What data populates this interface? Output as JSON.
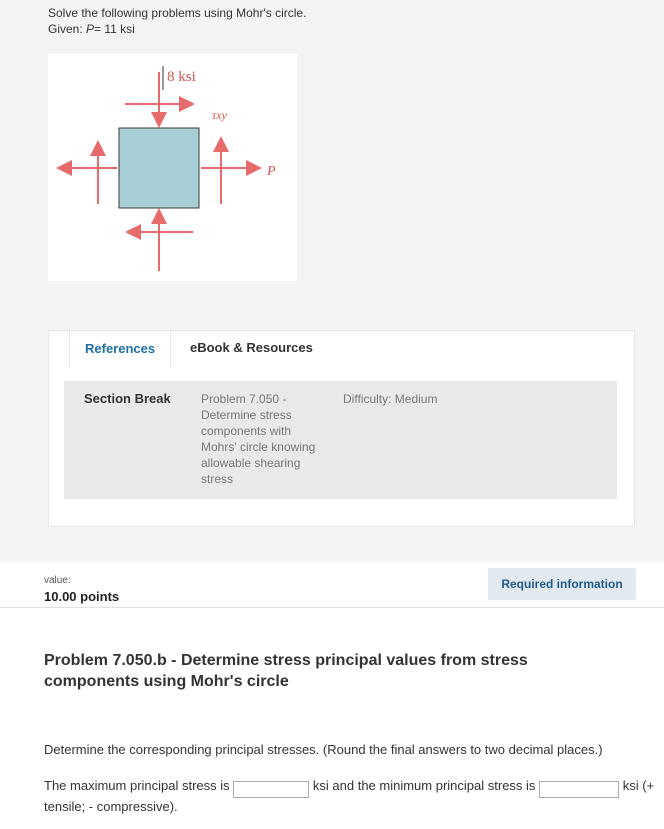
{
  "intro": {
    "line1": "Solve the following problems using Mohr's circle.",
    "given_prefix": "Given: ",
    "given_var": "P",
    "given_rest": "= 11 ksi"
  },
  "figure": {
    "stress_label": "8 ksi",
    "shear_label": "τxy",
    "load_label": "P",
    "colors": {
      "arrow": "#e86b6b",
      "element_fill": "#a9cfd6",
      "element_stroke": "#3a3a3a"
    }
  },
  "tabs": {
    "references": "References",
    "ebook": "eBook & Resources"
  },
  "section": {
    "head": "Section Break",
    "problem": "Problem 7.050 - Determine stress components with Mohrs' circle knowing allowable shearing stress",
    "difficulty": "Difficulty: Medium"
  },
  "value": {
    "label": "value:",
    "points": "10.00 points"
  },
  "required_button": "Required information",
  "problem_title": "Problem 7.050.b - Determine stress principal values from stress components using Mohr's circle",
  "question": "Determine the corresponding principal stresses. (Round the final answers to two decimal places.)",
  "answer": {
    "part1": "The maximum principal stress is",
    "part2": "ksi and the minimum principal stress is",
    "part3": "ksi (+ tensile; - compressive).",
    "max_value": "",
    "min_value": ""
  },
  "colors": {
    "link": "#1f6fa8",
    "button_bg": "#e2e9ef",
    "page_bg": "#f4f4f4"
  }
}
